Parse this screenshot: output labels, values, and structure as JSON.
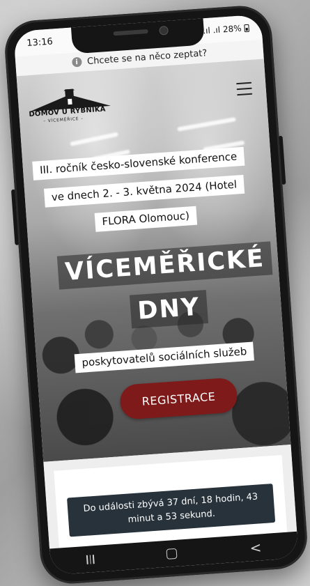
{
  "status_bar": {
    "time": "13:16",
    "signal": ".ıl .ıl",
    "battery": "28%"
  },
  "notice": {
    "text": "Chcete se na něco zeptat?"
  },
  "header": {
    "logo_title": "DOMOV U RYBNÍKA",
    "logo_subtitle": "– VÍCEMĚŘICE –"
  },
  "hero": {
    "line1": "III. ročník česko-slovenské konference",
    "line2": "ve dnech 2. - 3. května 2024 (Hotel",
    "line3": "FLORA Olomouc)",
    "title1": "VÍCEMĚŘICKÉ",
    "title2": "DNY",
    "subtitle": "poskytovatelů sociálních služeb",
    "cta": "REGISTRACE"
  },
  "countdown": {
    "text": "Do události zbývá 37 dní, 18 hodin, 43 minut a 53 sekund."
  },
  "colors": {
    "cta": "#7e1a1a",
    "countdown_bg": "#27323b"
  }
}
